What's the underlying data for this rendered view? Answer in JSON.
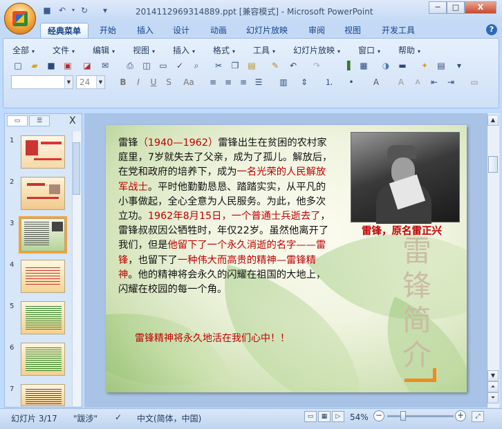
{
  "window": {
    "title": "2014112969314889.ppt [兼容模式] - Microsoft PowerPoint",
    "minimize": "─",
    "restore": "□",
    "close": "X"
  },
  "quick_access": {
    "save_icon": "save-icon",
    "undo_icon": "undo-icon",
    "redo_icon": "redo-icon",
    "undo": "↶",
    "redo": "↻",
    "customize": "▾"
  },
  "ribbon_tabs": [
    "经典菜单",
    "开始",
    "插入",
    "设计",
    "动画",
    "幻灯片放映",
    "审阅",
    "视图",
    "开发工具"
  ],
  "active_tab": 0,
  "help": "?",
  "classic_menu": [
    "全部",
    "文件",
    "编辑",
    "视图",
    "插入",
    "格式",
    "工具",
    "幻灯片放映",
    "窗口",
    "帮助"
  ],
  "font": {
    "name": "",
    "size": "24"
  },
  "left_pane": {
    "slide_numbers": [
      "1",
      "2",
      "3",
      "4",
      "5",
      "6",
      "7"
    ],
    "selected": 2,
    "close": "X"
  },
  "slide": {
    "body_segments": [
      {
        "text": "雷锋",
        "red": false
      },
      {
        "text": "（1940—1962）",
        "red": true
      },
      {
        "text": "雷锋出生在贫困的农村家庭里，7岁就失去了父亲，成为了孤儿。解放后，在党和政府的培养下，成为",
        "red": false
      },
      {
        "text": "一名光荣的人民解放军战士",
        "red": true
      },
      {
        "text": "。平时他勤勤恳恳、踏踏实实，从平凡的小事做起，全心全意为人民服务。为此，他多次立功。",
        "red": false
      },
      {
        "text": "1962年8月15日，一个普通士兵逝去了",
        "red": true
      },
      {
        "text": "，雷锋叔叔因公牺牲时，年仅22岁。虽然他离开了我们，但是",
        "red": false
      },
      {
        "text": "他留下了一个永久消逝的名字——雷锋",
        "red": true
      },
      {
        "text": "，也留下了",
        "red": false
      },
      {
        "text": "一种伟大而高贵的精神—雷锋精神",
        "red": true
      },
      {
        "text": "。他的精神将会永久的闪耀在祖国的大地上，闪耀在校园的每一个角。",
        "red": false
      }
    ],
    "closing": "雷锋精神将永久地活在我们心中！！",
    "photo_caption": "雷锋，原名雷正兴",
    "vertical_title": "雷锋简介"
  },
  "status_bar": {
    "slide_info": "幻灯片 3/17",
    "theme": "\"跋涉\"",
    "language": "中文(简体，中国)",
    "zoom": "54%",
    "zoom_level": 0.54
  },
  "colors": {
    "accent_red": "#c00000",
    "ribbon_blue": "#bfdbff",
    "selection_orange": "#f3a338"
  }
}
